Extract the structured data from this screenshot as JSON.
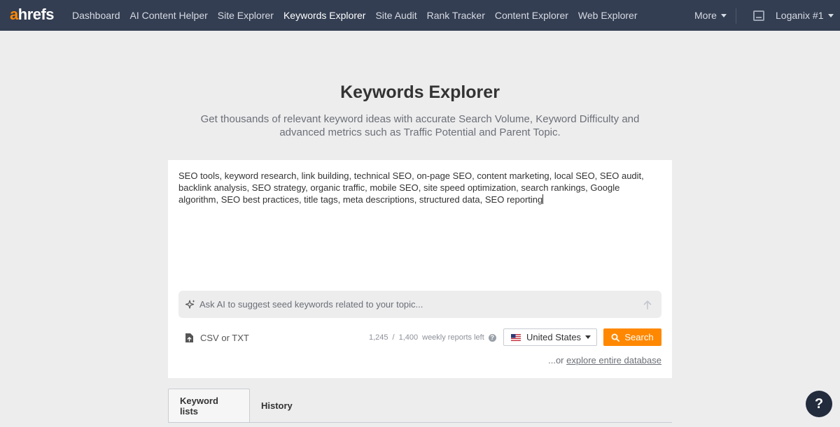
{
  "nav": {
    "logo_accent": "a",
    "logo_rest": "hrefs",
    "items": [
      {
        "label": "Dashboard"
      },
      {
        "label": "AI Content Helper"
      },
      {
        "label": "Site Explorer"
      },
      {
        "label": "Keywords Explorer"
      },
      {
        "label": "Site Audit"
      },
      {
        "label": "Rank Tracker"
      },
      {
        "label": "Content Explorer"
      },
      {
        "label": "Web Explorer"
      }
    ],
    "active_item": "Keywords Explorer",
    "more_label": "More",
    "account_label": "Loganix #1"
  },
  "hero": {
    "title": "Keywords Explorer",
    "subtitle": "Get thousands of relevant keyword ideas with accurate Search Volume, Keyword Difficulty and advanced metrics such as Traffic Potential and Parent Topic."
  },
  "panel": {
    "keywords_value": "SEO tools, keyword research, link building, technical SEO, on-page SEO, content marketing, local SEO, SEO audit, backlink analysis, SEO strategy, organic traffic, mobile SEO, site speed optimization, search rankings, Google algorithm, SEO best practices, title tags, meta descriptions, structured data, SEO reporting",
    "ai_placeholder": "Ask AI to suggest seed keywords related to your topic...",
    "upload_label": "CSV or TXT",
    "reports_used": "1,245",
    "reports_separator": "/",
    "reports_total": "1,400",
    "reports_suffix": "weekly reports left",
    "country": "United States",
    "search_label": "Search",
    "explore_prefix": "...or ",
    "explore_link": "explore entire database"
  },
  "tabs": [
    {
      "label": "Keyword lists"
    },
    {
      "label": "History"
    }
  ],
  "help_label": "?",
  "colors": {
    "topbar": "#333e52",
    "accent": "#ff8800",
    "page_bg": "#ededee",
    "help_fab": "#222c3d"
  },
  "icons": [
    "sparkle-icon",
    "arrow-up-icon",
    "upload-icon",
    "help-circle-icon",
    "us-flag-icon",
    "search-icon",
    "chevron-down-icon",
    "screen-icon",
    "question-icon"
  ]
}
